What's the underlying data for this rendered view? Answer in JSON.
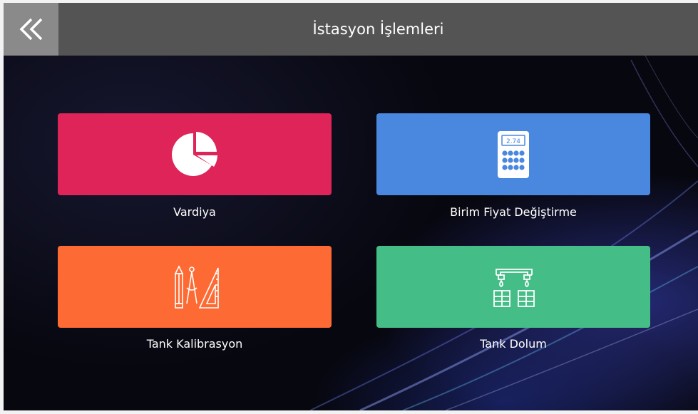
{
  "header": {
    "back_icon": "double-chevron-left-icon",
    "title": "İstasyon İşlemleri"
  },
  "tiles": [
    {
      "label": "Vardiya",
      "color": "#de2459",
      "icon": "pie-chart-icon"
    },
    {
      "label": "Birim Fiyat Değiştirme",
      "color": "#4a88e0",
      "icon": "calculator-icon",
      "icon_text": "2.74"
    },
    {
      "label": "Tank Kalibrasyon",
      "color": "#fe6a33",
      "icon": "drafting-tools-icon"
    },
    {
      "label": "Tank Dolum",
      "color": "#45bd87",
      "icon": "fuel-tap-barrels-icon"
    }
  ]
}
